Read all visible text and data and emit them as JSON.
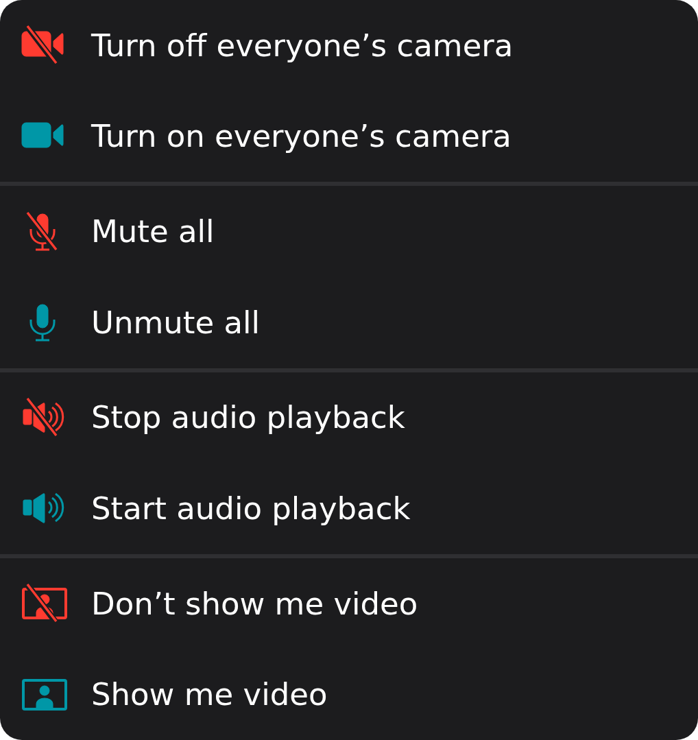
{
  "menu": {
    "groups": [
      {
        "items": [
          {
            "kind": "camera",
            "off": true,
            "label": "Turn off everyone’s camera"
          },
          {
            "kind": "camera",
            "off": false,
            "label": "Turn on everyone’s camera"
          }
        ]
      },
      {
        "items": [
          {
            "kind": "microphone",
            "off": true,
            "label": "Mute all"
          },
          {
            "kind": "microphone",
            "off": false,
            "label": "Unmute all"
          }
        ]
      },
      {
        "items": [
          {
            "kind": "speaker",
            "off": true,
            "label": "Stop audio playback"
          },
          {
            "kind": "speaker",
            "off": false,
            "label": "Start audio playback"
          }
        ]
      },
      {
        "items": [
          {
            "kind": "video",
            "off": true,
            "label": "Don’t show me video"
          },
          {
            "kind": "video",
            "off": false,
            "label": "Show me video"
          }
        ]
      }
    ]
  }
}
